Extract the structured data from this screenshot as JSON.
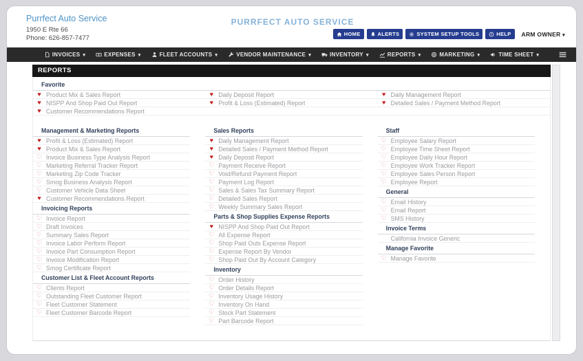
{
  "theme": {
    "accent_blue": "#4e93c6",
    "title_blue": "#85b2d8",
    "button_navy": "#253c8f",
    "heart_filled": "#c51f1f",
    "heart_outline": "#dd8181"
  },
  "header": {
    "company": {
      "name": "Purrfect Auto Service",
      "address": "1950 E Rte 66",
      "phone": "Phone: 626-857-7477"
    },
    "title": "PURRFECT AUTO SERVICE",
    "buttons": [
      {
        "label": "HOME",
        "icon": "home-icon"
      },
      {
        "label": "ALERTS",
        "icon": "bell-icon"
      },
      {
        "label": "SYSTEM SETUP TOOLS",
        "icon": "gears-icon"
      },
      {
        "label": "HELP",
        "icon": "help-icon"
      }
    ],
    "user_menu": {
      "label": "ARM OWNER",
      "caret": "▾"
    }
  },
  "nav": {
    "caret": "▾",
    "menu_icon": "menu-icon",
    "items": [
      {
        "label": "INVOICES",
        "icon": "invoice-icon"
      },
      {
        "label": "EXPENSES",
        "icon": "expenses-icon"
      },
      {
        "label": "FLEET ACCOUNTS",
        "icon": "person-icon"
      },
      {
        "label": "VENDOR MAINTENANCE",
        "icon": "wrench-icon"
      },
      {
        "label": "INVENTORY",
        "icon": "truck-icon"
      },
      {
        "label": "REPORTS",
        "icon": "chart-icon"
      },
      {
        "label": "MARKETING",
        "icon": "target-icon"
      },
      {
        "label": "TIME SHEET",
        "icon": "megaphone-icon"
      }
    ]
  },
  "page_title": "REPORTS",
  "favorites": {
    "heading": "Favorite",
    "rows": [
      [
        {
          "label": "Product Mix & Sales Report",
          "fav": true
        },
        {
          "label": "Daily Deposit Report",
          "fav": true
        },
        {
          "label": "Daily Management Report",
          "fav": true
        }
      ],
      [
        {
          "label": "NISPP And Shop Paid Out Report",
          "fav": true
        },
        {
          "label": "Profit & Loss (Estimated) Report",
          "fav": true
        },
        {
          "label": "Detailed Sales / Payment Method Report",
          "fav": true
        }
      ],
      [
        {
          "label": "Customer Recommendations Report",
          "fav": true
        },
        null,
        null
      ]
    ]
  },
  "sections": {
    "col1": [
      {
        "heading": "Management & Marketing Reports",
        "items": [
          {
            "label": "Profit & Loss (Estimated) Report",
            "fav": true
          },
          {
            "label": "Product Mix & Sales Report",
            "fav": true
          },
          {
            "label": "Invoice Business Type Analysis Report",
            "fav": false
          },
          {
            "label": "Marketing Referral Tracker Report",
            "fav": false
          },
          {
            "label": "Marketing Zip Code Tracker",
            "fav": false
          },
          {
            "label": "Smog Business Analysis Report",
            "fav": false
          },
          {
            "label": "Customer Vehicle Data Sheet",
            "fav": false
          },
          {
            "label": "Customer Recommendations Report",
            "fav": true
          }
        ]
      },
      {
        "heading": "Invoicing Reports",
        "items": [
          {
            "label": "Invoice Report",
            "fav": false
          },
          {
            "label": "Draft Invoices",
            "fav": false
          },
          {
            "label": "Summary Sales Report",
            "fav": false
          },
          {
            "label": "Invoice Labor Perform Report",
            "fav": false
          },
          {
            "label": "Invoice Part Consumption Report",
            "fav": false
          },
          {
            "label": "Invoice Modification Report",
            "fav": false
          },
          {
            "label": "Smog Certificate Report",
            "fav": false
          }
        ]
      },
      {
        "heading": "Customer List & Fleet Account Reports",
        "items": [
          {
            "label": "Clients Report",
            "fav": false
          },
          {
            "label": "Outstanding Fleet Customer Report",
            "fav": false
          },
          {
            "label": "Fleet Customer Statement",
            "fav": false
          },
          {
            "label": "Fleet Customer Barcode Report",
            "fav": false
          }
        ]
      }
    ],
    "col2": [
      {
        "heading": "Sales Reports",
        "items": [
          {
            "label": "Daily Management Report",
            "fav": true
          },
          {
            "label": "Detailed Sales / Payment Method Report",
            "fav": true
          },
          {
            "label": "Daily Deposit Report",
            "fav": true
          },
          {
            "label": "Payment Receive Report",
            "fav": false
          },
          {
            "label": "Void/Refund Payment Report",
            "fav": false
          },
          {
            "label": "Payment Log Report",
            "fav": false
          },
          {
            "label": "Sales & Sales Tax Summary Report",
            "fav": false
          },
          {
            "label": "Detailed Sales Report",
            "fav": false
          },
          {
            "label": "Weekly Summary Sales Report",
            "fav": false
          }
        ]
      },
      {
        "heading": "Parts & Shop Supplies Expense Reports",
        "items": [
          {
            "label": "NISPP And Shop Paid Out Report",
            "fav": true
          },
          {
            "label": "All Expense Report",
            "fav": false
          },
          {
            "label": "Shop Paid Outs Expense Report",
            "fav": false
          },
          {
            "label": "Expense Report By Vendor",
            "fav": false
          },
          {
            "label": "Shop Paid Out By Account Category",
            "fav": false
          }
        ]
      },
      {
        "heading": "Inventory",
        "items": [
          {
            "label": "Order History",
            "fav": false
          },
          {
            "label": "Order Details Report",
            "fav": false
          },
          {
            "label": "Inventory Usage History",
            "fav": false
          },
          {
            "label": "Inventory On Hand",
            "fav": false
          },
          {
            "label": "Stock Part Statement",
            "fav": false
          },
          {
            "label": "Part Barcode Report",
            "fav": false
          }
        ]
      }
    ],
    "col3": [
      {
        "heading": "Staff",
        "items": [
          {
            "label": "Employee Salary Report",
            "fav": false
          },
          {
            "label": "Employee Time Sheet Report",
            "fav": false
          },
          {
            "label": "Employee Daily Hour Report",
            "fav": false
          },
          {
            "label": "Employee Work Tracker Report",
            "fav": false
          },
          {
            "label": "Employee Sales Person Report",
            "fav": false
          },
          {
            "label": "Employee Report",
            "fav": false
          }
        ]
      },
      {
        "heading": "General",
        "items": [
          {
            "label": "Email History",
            "fav": false
          },
          {
            "label": "Email Report",
            "fav": false
          },
          {
            "label": "SMS History",
            "fav": false
          }
        ]
      },
      {
        "heading": "Invoice Terms",
        "items": [
          {
            "label": "California Invoice Generic",
            "fav": null
          }
        ]
      },
      {
        "heading": "Manage Favorite",
        "items": [
          {
            "label": "Manage Favorite",
            "fav": false
          }
        ]
      }
    ]
  }
}
